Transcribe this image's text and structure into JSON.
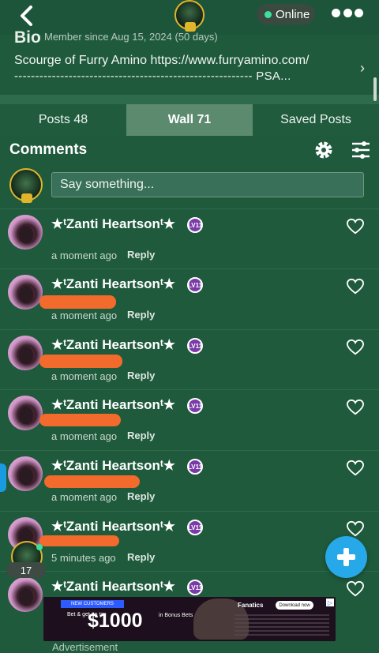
{
  "header": {
    "status": "Online"
  },
  "bio": {
    "title": "Bio",
    "member_since": "Member since Aug 15, 2024 (50 days)",
    "text": "Scourge of Furry Amino https://www.furryamino.com/",
    "dashes": "--------------------------------------------------------- PSA..."
  },
  "tabs": [
    {
      "label": "Posts 48"
    },
    {
      "label": "Wall 71"
    },
    {
      "label": "Saved Posts"
    }
  ],
  "comments": {
    "title": "Comments",
    "placeholder": "Say something...",
    "items": [
      {
        "author": "★ᵗZanti Heartsonᵗ★",
        "level": "LV11",
        "time": "a moment ago",
        "reply": "Reply"
      },
      {
        "author": "★ᵗZanti Heartsonᵗ★",
        "level": "LV11",
        "time": "a moment ago",
        "reply": "Reply"
      },
      {
        "author": "★ᵗZanti Heartsonᵗ★",
        "level": "LV11",
        "time": "a moment ago",
        "reply": "Reply"
      },
      {
        "author": "★ᵗZanti Heartsonᵗ★",
        "level": "LV11",
        "time": "a moment ago",
        "reply": "Reply"
      },
      {
        "author": "★ᵗZanti Heartsonᵗ★",
        "level": "LV11",
        "time": "a moment ago",
        "reply": "Reply"
      },
      {
        "author": "★ᵗZanti Heartsonᵗ★",
        "level": "LV11",
        "time": "5 minutes ago",
        "reply": "Reply"
      },
      {
        "author": "★ᵗZanti Heartsonᵗ★",
        "level": "LV11",
        "time": "",
        "reply": ""
      }
    ]
  },
  "floating": {
    "count": "17"
  },
  "ad": {
    "badge": "NEW CUSTOMERS",
    "bet_text": "Bet & get up to",
    "amount": "$1000",
    "bonus_text": "in Bonus Bets",
    "brand": "Fanatics",
    "download": "Download now",
    "label": "Advertisement"
  }
}
